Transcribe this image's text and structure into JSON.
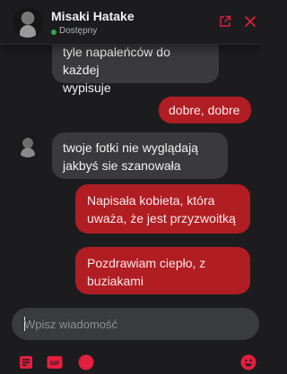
{
  "header": {
    "contact_name": "Misaki Hatake",
    "status": "Dostępny",
    "status_color": "#31a24c"
  },
  "messages": [
    {
      "direction": "in",
      "text": "tyle napaleńców do każdej\nwypisuje"
    },
    {
      "direction": "out",
      "text": "dobre, dobre"
    },
    {
      "direction": "in",
      "text": "twoje fotki nie wyglądają\njakbyś sie szanowała"
    },
    {
      "direction": "out",
      "text": "Napisała kobieta, która\nuważa, że jest przyzwoitką"
    },
    {
      "direction": "out",
      "text": "Pozdrawiam ciepło, z\nbuziakami"
    }
  ],
  "composer": {
    "placeholder": "Wpisz wiadomość",
    "gif_label": "GIF"
  },
  "colors": {
    "accent": "#e41e3f",
    "outgoing_bubble": "#b01d23",
    "incoming_bubble": "#3a3a3c",
    "background": "#1c1c1e"
  },
  "icons": {
    "header_popout": "external-link-icon",
    "header_close": "close-icon",
    "toolbar": [
      "file-icon",
      "gif-icon",
      "sticker-icon",
      "emoji-icon"
    ]
  }
}
